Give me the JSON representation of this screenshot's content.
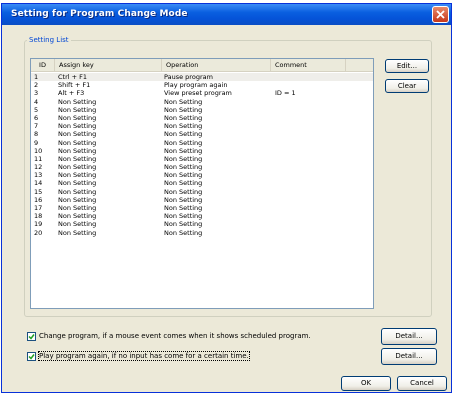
{
  "window": {
    "title": "Setting for Program Change Mode"
  },
  "group": {
    "label": "Setting List"
  },
  "table": {
    "columns": [
      "ID",
      "Assign key",
      "Operation",
      "Comment"
    ],
    "rows": [
      {
        "id": "1",
        "key": "Ctrl + F1",
        "op": "Pause program",
        "comment": ""
      },
      {
        "id": "2",
        "key": "Shift + F1",
        "op": "Play program again",
        "comment": ""
      },
      {
        "id": "3",
        "key": "Alt + F3",
        "op": "View preset program",
        "comment": "ID = 1"
      },
      {
        "id": "4",
        "key": "Non Setting",
        "op": "Non Setting",
        "comment": ""
      },
      {
        "id": "5",
        "key": "Non Setting",
        "op": "Non Setting",
        "comment": ""
      },
      {
        "id": "6",
        "key": "Non Setting",
        "op": "Non Setting",
        "comment": ""
      },
      {
        "id": "7",
        "key": "Non Setting",
        "op": "Non Setting",
        "comment": ""
      },
      {
        "id": "8",
        "key": "Non Setting",
        "op": "Non Setting",
        "comment": ""
      },
      {
        "id": "9",
        "key": "Non Setting",
        "op": "Non Setting",
        "comment": ""
      },
      {
        "id": "10",
        "key": "Non Setting",
        "op": "Non Setting",
        "comment": ""
      },
      {
        "id": "11",
        "key": "Non Setting",
        "op": "Non Setting",
        "comment": ""
      },
      {
        "id": "12",
        "key": "Non Setting",
        "op": "Non Setting",
        "comment": ""
      },
      {
        "id": "13",
        "key": "Non Setting",
        "op": "Non Setting",
        "comment": ""
      },
      {
        "id": "14",
        "key": "Non Setting",
        "op": "Non Setting",
        "comment": ""
      },
      {
        "id": "15",
        "key": "Non Setting",
        "op": "Non Setting",
        "comment": ""
      },
      {
        "id": "16",
        "key": "Non Setting",
        "op": "Non Setting",
        "comment": ""
      },
      {
        "id": "17",
        "key": "Non Setting",
        "op": "Non Setting",
        "comment": ""
      },
      {
        "id": "18",
        "key": "Non Setting",
        "op": "Non Setting",
        "comment": ""
      },
      {
        "id": "19",
        "key": "Non Setting",
        "op": "Non Setting",
        "comment": ""
      },
      {
        "id": "20",
        "key": "Non Setting",
        "op": "Non Setting",
        "comment": ""
      }
    ]
  },
  "buttons": {
    "edit": "Edit...",
    "clear": "Clear",
    "detail1": "Detail...",
    "detail2": "Detail...",
    "ok": "OK",
    "cancel": "Cancel"
  },
  "options": {
    "change_program": {
      "label": "Change program, if a mouse event comes when it shows scheduled program.",
      "checked": true
    },
    "play_again": {
      "label": "Play program again, if no input has come for a certain time.",
      "checked": true
    }
  },
  "colors": {
    "titlebar": "#0a5fe0",
    "group_label": "#0046d5",
    "dialog_bg": "#ece9d8"
  },
  "icons": {
    "close": "close-icon",
    "checkmark": "checkmark-icon"
  }
}
